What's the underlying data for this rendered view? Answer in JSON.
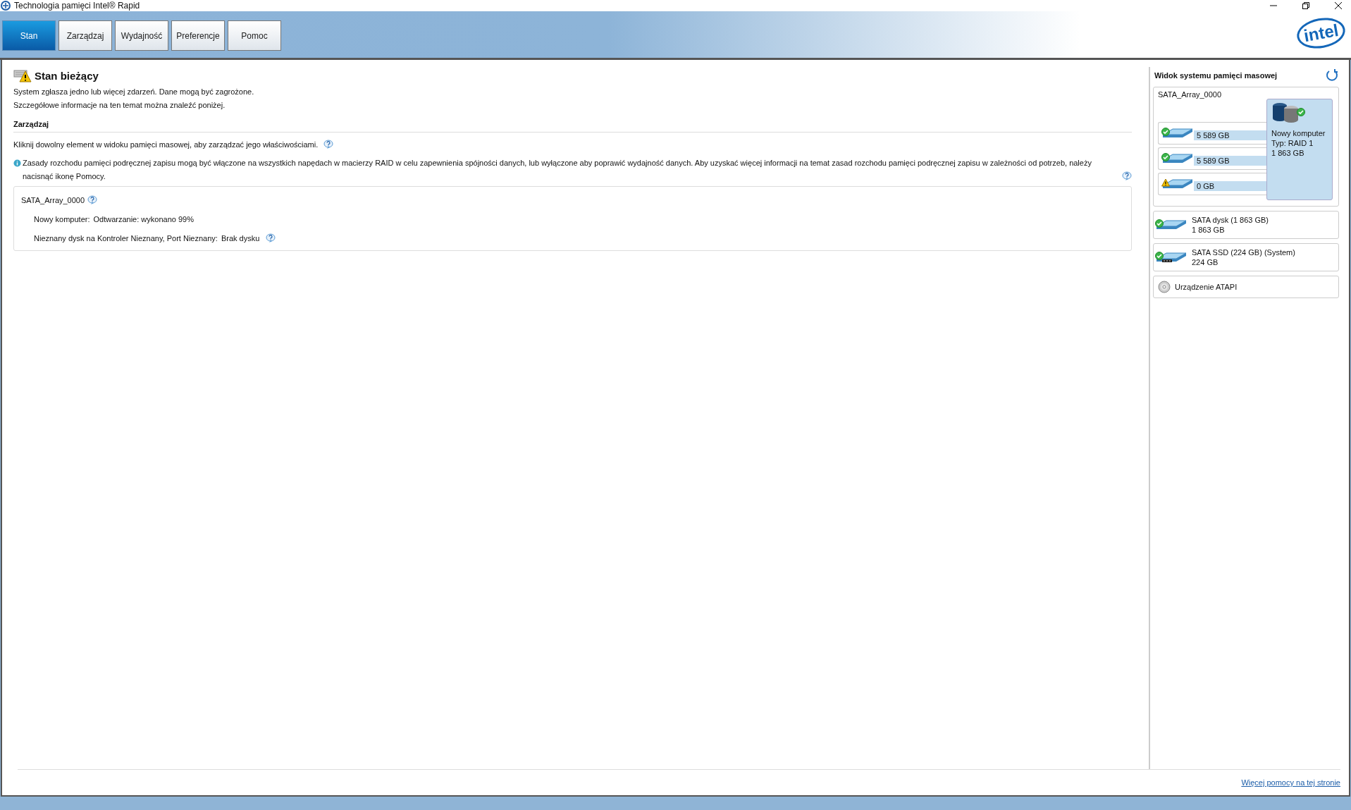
{
  "window": {
    "title": "Technologia pamięci Intel® Rapid"
  },
  "tabs": [
    {
      "label": "Stan",
      "selected": true
    },
    {
      "label": "Zarządzaj",
      "selected": false
    },
    {
      "label": "Wydajność",
      "selected": false
    },
    {
      "label": "Preferencje",
      "selected": false
    },
    {
      "label": "Pomoc",
      "selected": false
    }
  ],
  "logo": "intel",
  "status": {
    "title": "Stan bieżący",
    "lines": [
      "System zgłasza jedno lub więcej zdarzeń. Dane mogą być zagrożone.",
      "Szczegółowe informacje na ten temat można znaleźć poniżej."
    ]
  },
  "manage": {
    "heading": "Zarządzaj",
    "hint": "Kliknij dowolny element w widoku pamięci masowej, aby zarządzać jego właściwościami.",
    "info": "Zasady rozchodu pamięci podręcznej zapisu mogą być włączone na wszystkich napędach w macierzy RAID w celu zapewnienia spójności danych, lub wyłączone aby poprawić wydajność danych. Aby uzyskać więcej informacji na temat  zasad rozchodu pamięci podręcznej zapisu w zależności od potrzeb, należy nacisnąć ikonę Pomocy.",
    "array": {
      "name": "SATA_Array_0000",
      "events": [
        {
          "label": "Nowy komputer:",
          "value": "Odtwarzanie: wykonano 99%",
          "help": false
        },
        {
          "label": "Nieznany dysk na Kontroler Nieznany, Port Nieznany:",
          "value": "Brak dysku",
          "help": true
        }
      ]
    }
  },
  "storage_view": {
    "title": "Widok systemu pamięci masowej",
    "array": {
      "name": "SATA_Array_0000",
      "disks": [
        {
          "size": "5 589 GB",
          "warning": false
        },
        {
          "size": "5 589 GB",
          "warning": false
        },
        {
          "size": "0 GB",
          "warning": true
        }
      ],
      "volume": {
        "name": "Nowy komputer",
        "type": "Typ: RAID 1",
        "size": "1 863 GB",
        "warning": false
      }
    },
    "devices": [
      {
        "kind": "hdd",
        "name": "SATA dysk (1 863 GB)",
        "size": "1 863 GB",
        "warning": false
      },
      {
        "kind": "ssd",
        "name": "SATA SSD (224 GB) (System)",
        "size": "224 GB",
        "warning": false
      },
      {
        "kind": "optical",
        "name": "Urządzenie ATAPI"
      }
    ]
  },
  "footer_link": "Więcej pomocy na tej stronie"
}
